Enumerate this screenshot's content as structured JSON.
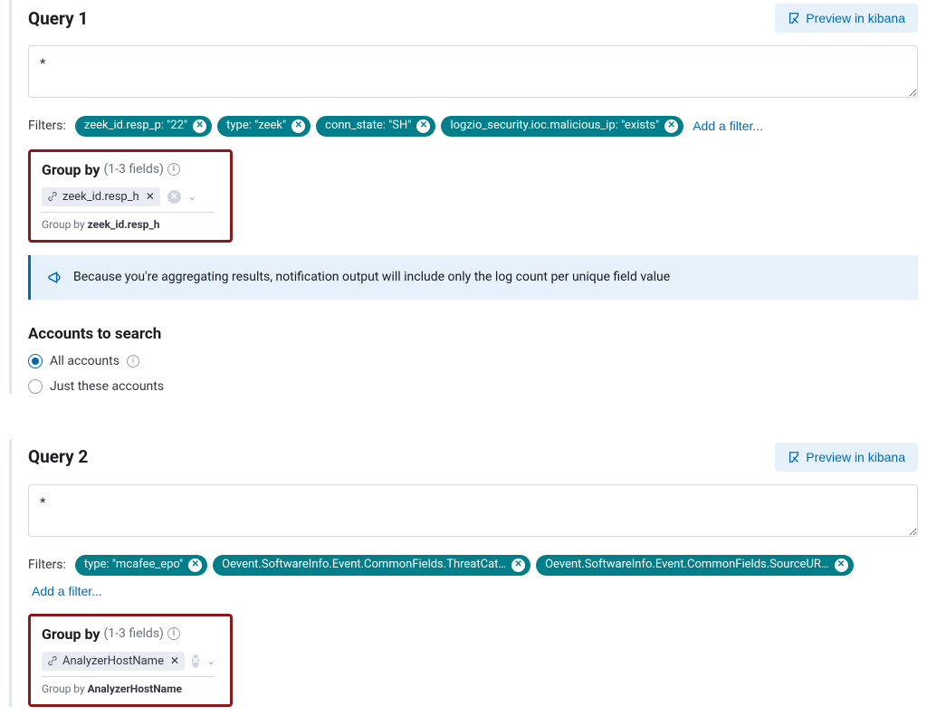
{
  "preview_label": "Preview in kibana",
  "filters_label": "Filters:",
  "add_filter_label": "Add a filter...",
  "groupby": {
    "title": "Group by",
    "sub": "(1-3 fields)",
    "caption_prefix": "Group by "
  },
  "banner": "Because you're aggregating results, notification output will include only the log count per unique field value",
  "accounts": {
    "title": "Accounts to search",
    "all": "All accounts",
    "just": "Just these accounts"
  },
  "queries": [
    {
      "title": "Query 1",
      "value": "*",
      "filters": [
        "zeek_id.resp_p: \"22\"",
        "type: \"zeek\"",
        "conn_state: \"SH\"",
        "logzio_security.ioc.malicious_ip: \"exists\""
      ],
      "group_field": "zeek_id.resp_h"
    },
    {
      "title": "Query 2",
      "value": "*",
      "filters": [
        "type: \"mcafee_epo\"",
        "Oevent.SoftwareInfo.Event.CommonFields.ThreatCat…",
        "Oevent.SoftwareInfo.Event.CommonFields.SourceUR…"
      ],
      "group_field": "AnalyzerHostName"
    }
  ]
}
